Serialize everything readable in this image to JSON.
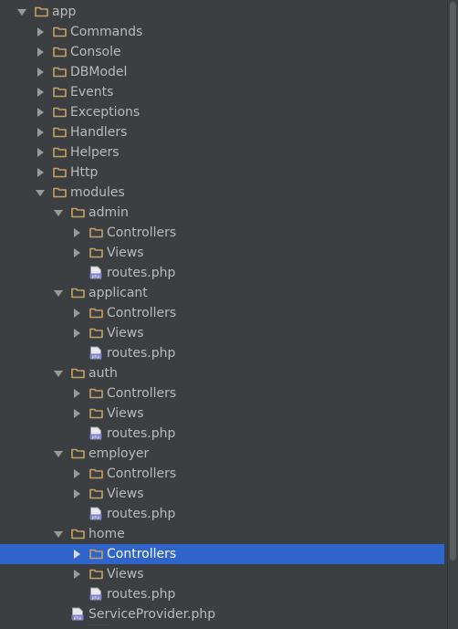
{
  "colors": {
    "background": "#3c3f41",
    "text": "#bbbbbb",
    "selection": "#2f65ca",
    "folder_icon": "#c6a164",
    "php_icon": "#7b7fd0"
  },
  "tree": [
    {
      "label": "app",
      "depth": 0,
      "type": "folder",
      "state": "expanded",
      "selected": false
    },
    {
      "label": "Commands",
      "depth": 1,
      "type": "folder",
      "state": "collapsed",
      "selected": false
    },
    {
      "label": "Console",
      "depth": 1,
      "type": "folder",
      "state": "collapsed",
      "selected": false
    },
    {
      "label": "DBModel",
      "depth": 1,
      "type": "folder",
      "state": "collapsed",
      "selected": false
    },
    {
      "label": "Events",
      "depth": 1,
      "type": "folder",
      "state": "collapsed",
      "selected": false
    },
    {
      "label": "Exceptions",
      "depth": 1,
      "type": "folder",
      "state": "collapsed",
      "selected": false
    },
    {
      "label": "Handlers",
      "depth": 1,
      "type": "folder",
      "state": "collapsed",
      "selected": false
    },
    {
      "label": "Helpers",
      "depth": 1,
      "type": "folder",
      "state": "collapsed",
      "selected": false
    },
    {
      "label": "Http",
      "depth": 1,
      "type": "folder",
      "state": "collapsed",
      "selected": false
    },
    {
      "label": "modules",
      "depth": 1,
      "type": "folder",
      "state": "expanded",
      "selected": false
    },
    {
      "label": "admin",
      "depth": 2,
      "type": "folder",
      "state": "expanded",
      "selected": false
    },
    {
      "label": "Controllers",
      "depth": 3,
      "type": "folder",
      "state": "collapsed",
      "selected": false
    },
    {
      "label": "Views",
      "depth": 3,
      "type": "folder",
      "state": "collapsed",
      "selected": false
    },
    {
      "label": "routes.php",
      "depth": 3,
      "type": "php",
      "state": "none",
      "selected": false
    },
    {
      "label": "applicant",
      "depth": 2,
      "type": "folder",
      "state": "expanded",
      "selected": false
    },
    {
      "label": "Controllers",
      "depth": 3,
      "type": "folder",
      "state": "collapsed",
      "selected": false
    },
    {
      "label": "Views",
      "depth": 3,
      "type": "folder",
      "state": "collapsed",
      "selected": false
    },
    {
      "label": "routes.php",
      "depth": 3,
      "type": "php",
      "state": "none",
      "selected": false
    },
    {
      "label": "auth",
      "depth": 2,
      "type": "folder",
      "state": "expanded",
      "selected": false
    },
    {
      "label": "Controllers",
      "depth": 3,
      "type": "folder",
      "state": "collapsed",
      "selected": false
    },
    {
      "label": "Views",
      "depth": 3,
      "type": "folder",
      "state": "collapsed",
      "selected": false
    },
    {
      "label": "routes.php",
      "depth": 3,
      "type": "php",
      "state": "none",
      "selected": false
    },
    {
      "label": "employer",
      "depth": 2,
      "type": "folder",
      "state": "expanded",
      "selected": false
    },
    {
      "label": "Controllers",
      "depth": 3,
      "type": "folder",
      "state": "collapsed",
      "selected": false
    },
    {
      "label": "Views",
      "depth": 3,
      "type": "folder",
      "state": "collapsed",
      "selected": false
    },
    {
      "label": "routes.php",
      "depth": 3,
      "type": "php",
      "state": "none",
      "selected": false
    },
    {
      "label": "home",
      "depth": 2,
      "type": "folder",
      "state": "expanded",
      "selected": false
    },
    {
      "label": "Controllers",
      "depth": 3,
      "type": "folder",
      "state": "collapsed",
      "selected": true
    },
    {
      "label": "Views",
      "depth": 3,
      "type": "folder",
      "state": "collapsed",
      "selected": false
    },
    {
      "label": "routes.php",
      "depth": 3,
      "type": "php",
      "state": "none",
      "selected": false
    },
    {
      "label": "ServiceProvider.php",
      "depth": 2,
      "type": "php",
      "state": "none",
      "selected": false
    }
  ]
}
